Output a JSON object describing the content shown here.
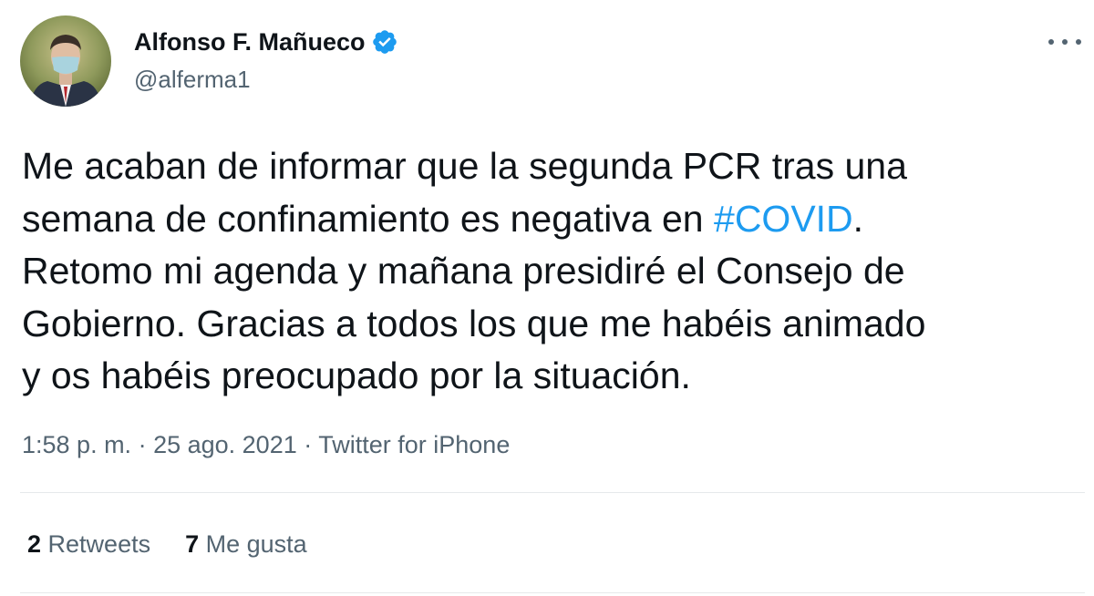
{
  "author": {
    "display_name": "Alfonso F. Mañueco",
    "handle": "@alferma1",
    "verified": true,
    "verified_color": "#1d9bf0",
    "avatar_icon": "profile-photo"
  },
  "menu_icon": "more-horizontal-icon",
  "tweet": {
    "lines": [
      "Me acaban de informar que la segunda PCR tras una",
      "semana de confinamiento es negativa en ",
      "Retomo mi agenda y mañana presidiré el Consejo de",
      "Gobierno. Gracias a todos los que me habéis animado",
      "y os habéis preocupado por la situación."
    ],
    "hashtag": "#COVID",
    "after_hashtag": ".",
    "hashtag_color": "#1d9bf0"
  },
  "meta": {
    "time": "1:58 p. m.",
    "separator": " · ",
    "date": "25 ago. 2021",
    "source": "Twitter for iPhone"
  },
  "stats": {
    "retweets_count": "2",
    "retweets_label": " Retweets",
    "likes_count": "7",
    "likes_label": " Me gusta"
  }
}
